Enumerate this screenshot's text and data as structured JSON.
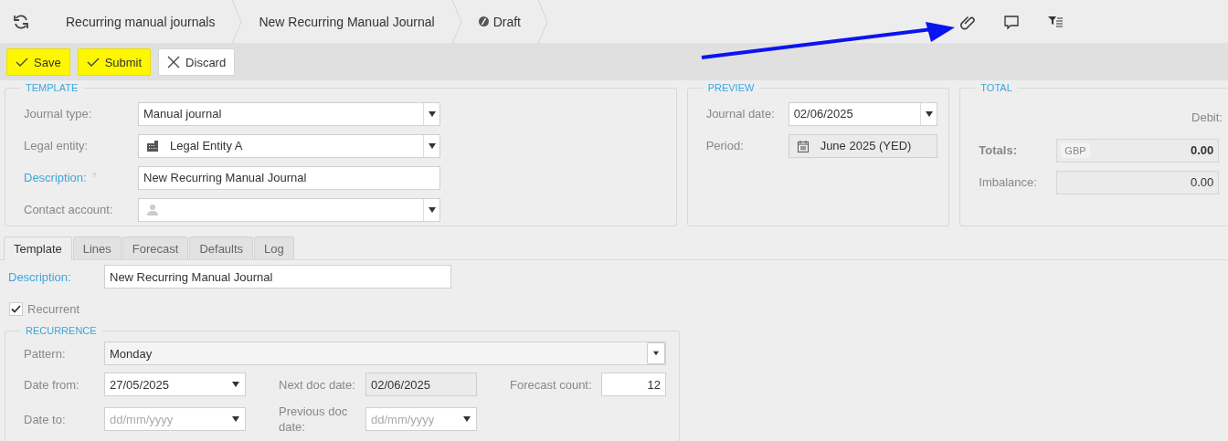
{
  "breadcrumbs": [
    {
      "label": "Recurring manual journals",
      "kind": "link"
    },
    {
      "label": "New Recurring Manual Journal",
      "kind": "link"
    },
    {
      "label": "Draft",
      "kind": "status"
    }
  ],
  "toolbar": [
    {
      "label": "Save",
      "kind": "primary"
    },
    {
      "label": "Submit",
      "kind": "primary"
    },
    {
      "label": "Discard",
      "kind": "cancel"
    }
  ],
  "template_panel": {
    "title": "TEMPLATE",
    "fields": [
      {
        "label": "Journal type:",
        "kind": "select",
        "value": "Manual journal",
        "required": false
      },
      {
        "label": "Legal entity:",
        "kind": "entity",
        "value": "Legal Entity A",
        "required": false
      },
      {
        "label": "Description:",
        "kind": "text",
        "value": "New Recurring Manual Journal",
        "required": true,
        "hint": "?"
      },
      {
        "label": "Contact account:",
        "kind": "contact",
        "required": false
      }
    ]
  },
  "preview_panel": {
    "title": "PREVIEW",
    "fields": [
      {
        "label": "Journal date:",
        "kind": "select",
        "value": "02/06/2025",
        "required": false
      },
      {
        "label": "Period:",
        "kind": "period",
        "value": "June 2025 (YED)",
        "required": false
      }
    ]
  },
  "total_panel": {
    "title": "TOTAL",
    "column_header": "Debit:",
    "totals": {
      "label": "Totals:",
      "currency": "GBP",
      "value": "0.00"
    },
    "imbalance": {
      "label": "Imbalance:",
      "value": "0.00"
    }
  },
  "tabs": [
    {
      "label": "Template",
      "selected": true
    },
    {
      "label": "Lines",
      "selected": false
    },
    {
      "label": "Forecast",
      "selected": false
    },
    {
      "label": "Defaults",
      "selected": false
    },
    {
      "label": "Log",
      "selected": false
    }
  ],
  "template_tab": {
    "description": {
      "label": "Description:",
      "value": "New Recurring Manual Journal"
    },
    "recurrent": {
      "label": "Recurrent",
      "checked": true
    },
    "recurrence": {
      "title": "RECURRENCE",
      "pattern": {
        "label": "Pattern:",
        "value": "Monday"
      },
      "date_from": {
        "label": "Date from:",
        "value": "27/05/2025"
      },
      "next_doc_date": {
        "label": "Next doc date:",
        "value": "02/06/2025"
      },
      "forecast_count": {
        "label": "Forecast count:",
        "value": "12"
      },
      "date_to": {
        "label": "Date to:",
        "placeholder": "dd/mm/yyyy"
      },
      "previous_doc_date": {
        "label": "Previous doc date:",
        "placeholder": "dd/mm/yyyy"
      }
    }
  }
}
